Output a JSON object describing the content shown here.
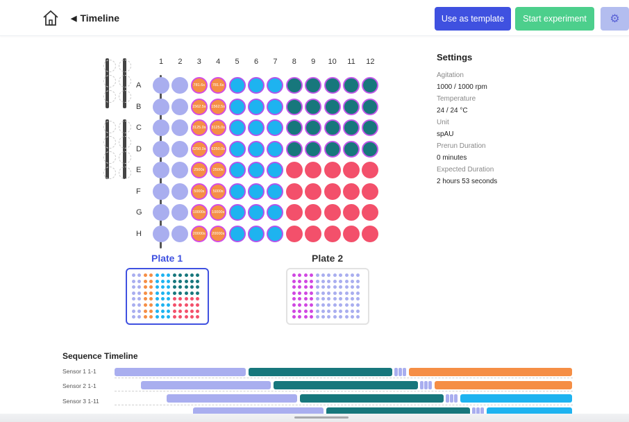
{
  "header": {
    "back_label": "Timeline",
    "template_label": "Use as template",
    "start_label": "Start experiment"
  },
  "plate": {
    "columns": [
      "1",
      "2",
      "3",
      "4",
      "5",
      "6",
      "7",
      "8",
      "9",
      "10",
      "11",
      "12"
    ],
    "rows": [
      "A",
      "B",
      "C",
      "D",
      "E",
      "F",
      "G",
      "H"
    ],
    "row_col_colors": [
      [
        "lav",
        "lav",
        "orange",
        "orange",
        "blue",
        "blue",
        "blue",
        "teal",
        "teal",
        "teal",
        "teal",
        "teal"
      ],
      [
        "lav",
        "lav",
        "orange",
        "orange",
        "blue",
        "blue",
        "blue",
        "teal",
        "teal",
        "teal",
        "teal",
        "teal"
      ],
      [
        "lav",
        "lav",
        "orange",
        "orange",
        "blue",
        "blue",
        "blue",
        "teal",
        "teal",
        "teal",
        "teal",
        "teal"
      ],
      [
        "lav",
        "lav",
        "orange",
        "orange",
        "blue",
        "blue",
        "blue",
        "teal",
        "teal",
        "teal",
        "teal",
        "teal"
      ],
      [
        "lav",
        "lav",
        "orange",
        "orange",
        "blue",
        "blue",
        "blue",
        "red",
        "red",
        "red",
        "red",
        "red"
      ],
      [
        "lav",
        "lav",
        "orange",
        "orange",
        "blue",
        "blue",
        "blue",
        "red",
        "red",
        "red",
        "red",
        "red"
      ],
      [
        "lav",
        "lav",
        "orange",
        "orange",
        "blue",
        "blue",
        "blue",
        "red",
        "red",
        "red",
        "red",
        "red"
      ],
      [
        "lav",
        "lav",
        "orange",
        "orange",
        "blue",
        "blue",
        "blue",
        "red",
        "red",
        "red",
        "red",
        "red"
      ]
    ],
    "well_labels": {
      "A3": "781.6s",
      "A4": "781.6s",
      "B3": "1562.5s",
      "B4": "1562.5s",
      "C3": "3125.0s",
      "C4": "3125.0s",
      "D3": "6250.0s",
      "D4": "6250.0s",
      "E3": "2500s",
      "E4": "2500s",
      "F3": "5000s",
      "F4": "5000s",
      "G3": "10000s",
      "G4": "10000s",
      "H3": "20000s",
      "H4": "20000s"
    }
  },
  "colors": {
    "lav": "#a9aeef",
    "orange": "#f58e45",
    "blue": "#1eb3f0",
    "teal": "#17777c",
    "red": "#f3506b",
    "pink": "#d047e2",
    "accent": "#3f51e0",
    "start": "#4ccf8c"
  },
  "plates": [
    {
      "label": "Plate 1",
      "active": true
    },
    {
      "label": "Plate 2",
      "active": false
    }
  ],
  "settings": {
    "title": "Settings",
    "items": [
      {
        "label": "Agitation",
        "value": "1000 / 1000 rpm"
      },
      {
        "label": "Temperature",
        "value": "24 / 24 °C"
      },
      {
        "label": "Unit",
        "value": "spAU"
      },
      {
        "label": "Prerun Duration",
        "value": "0 minutes"
      },
      {
        "label": "Expected Duration",
        "value": "2 hours 53 seconds"
      }
    ]
  },
  "timeline": {
    "title": "Sequence Timeline",
    "rows": [
      {
        "label": "Sensor 1 1-1"
      },
      {
        "label": "Sensor 2 1-1"
      },
      {
        "label": "Sensor 3 1-11"
      },
      {
        "label": ""
      }
    ]
  },
  "icons": {
    "home": "home-icon",
    "back": "back-arrow-icon",
    "gear": "gear-icon"
  }
}
